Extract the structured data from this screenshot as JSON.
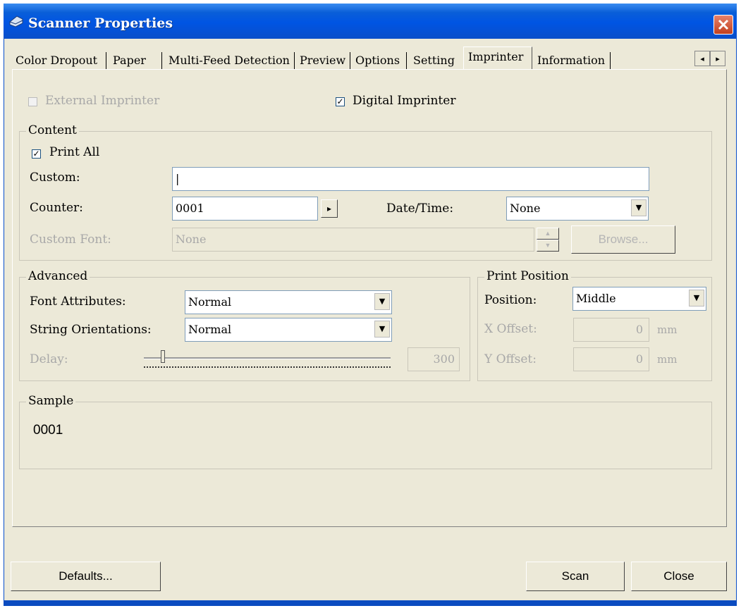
{
  "window": {
    "title": "Scanner Properties",
    "app_icon": "scanner-icon",
    "close_icon": "close-icon"
  },
  "tabs": [
    {
      "label": "Color Dropout"
    },
    {
      "label": "Paper"
    },
    {
      "label": "Multi-Feed Detection"
    },
    {
      "label": "Preview"
    },
    {
      "label": "Options"
    },
    {
      "label": "Setting"
    },
    {
      "label": "Imprinter",
      "active": true
    },
    {
      "label": "Information"
    }
  ],
  "tab_scroll": {
    "left": "◂",
    "right": "▸"
  },
  "imprinter": {
    "external_label": "External Imprinter",
    "external_checked": false,
    "digital_label": "Digital Imprinter",
    "digital_checked": true
  },
  "content": {
    "legend": "Content",
    "print_all_label": "Print All",
    "print_all_checked": true,
    "custom_label": "Custom:",
    "custom_value": "|",
    "counter_label": "Counter:",
    "counter_value": "0001",
    "counter_arrow": "▸",
    "datetime_label": "Date/Time:",
    "datetime_value": "None",
    "custom_font_label": "Custom Font:",
    "custom_font_value": "None",
    "browse_label": "Browse..."
  },
  "advanced": {
    "legend": "Advanced",
    "font_attr_label": "Font Attributes:",
    "font_attr_value": "Normal",
    "string_orient_label": "String Orientations:",
    "string_orient_value": "Normal",
    "delay_label": "Delay:",
    "delay_value": "300"
  },
  "print_position": {
    "legend": "Print Position",
    "position_label": "Position:",
    "position_value": "Middle",
    "x_offset_label": "X Offset:",
    "x_offset_value": "0",
    "y_offset_label": "Y Offset:",
    "y_offset_value": "0",
    "unit": "mm"
  },
  "sample": {
    "legend": "Sample",
    "value": "0001"
  },
  "buttons": {
    "defaults": "Defaults...",
    "scan": "Scan",
    "close": "Close"
  },
  "dropdown_arrow": "▼"
}
